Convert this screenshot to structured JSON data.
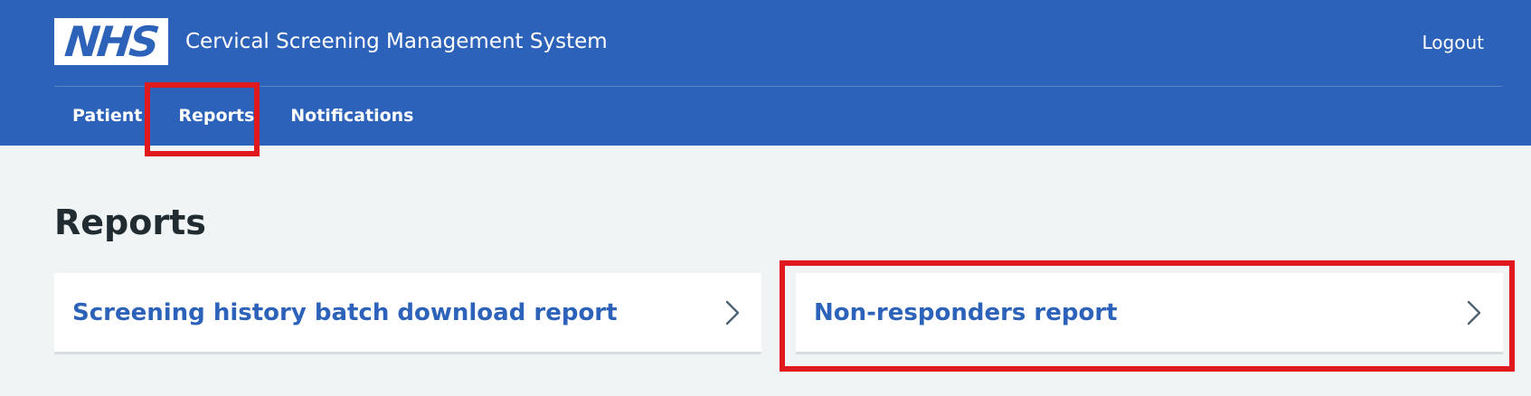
{
  "header": {
    "logo_text": "NHS",
    "app_title": "Cervical Screening Management System",
    "logout_label": "Logout"
  },
  "nav": {
    "items": [
      {
        "label": "Patient"
      },
      {
        "label": "Reports"
      },
      {
        "label": "Notifications"
      }
    ]
  },
  "main": {
    "page_title": "Reports",
    "cards": [
      {
        "label": "Screening history batch download report",
        "icon": "chevron-right-icon"
      },
      {
        "label": "Non-responders report",
        "icon": "chevron-right-icon"
      }
    ]
  },
  "colors": {
    "header_background": "#2c62b9",
    "page_background": "#f0f4f5",
    "link_color": "#2c62b9",
    "highlight_border": "#e0191f",
    "heading_text": "#212b32"
  }
}
